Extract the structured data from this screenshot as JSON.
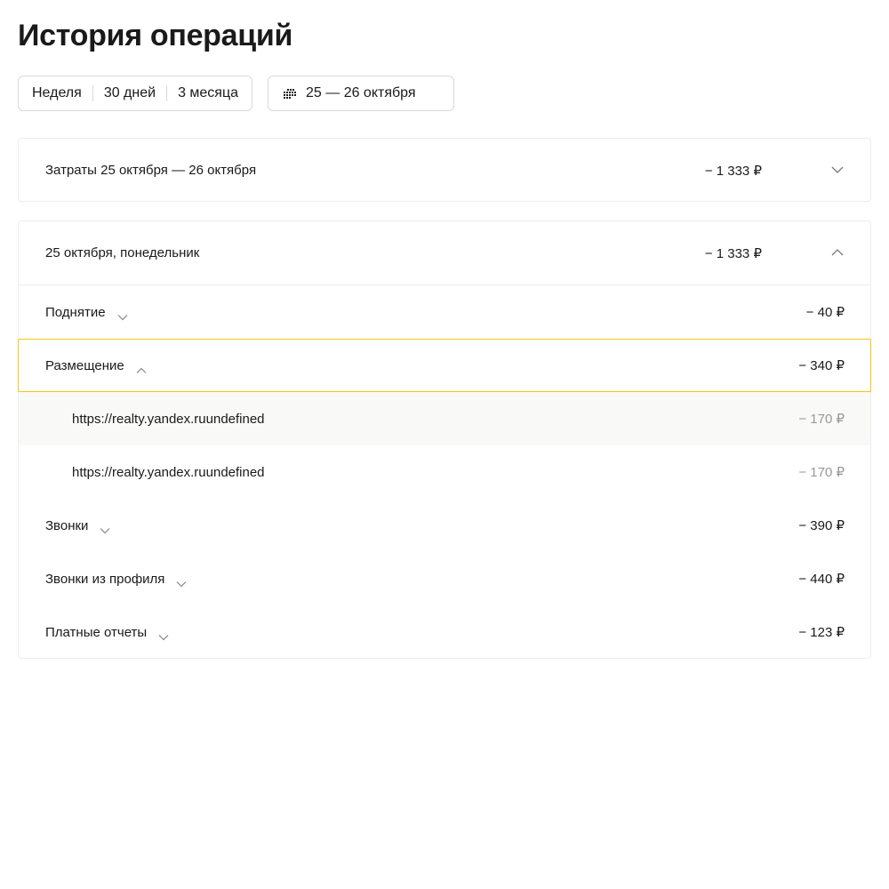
{
  "header": {
    "title": "История операций"
  },
  "period_switch": {
    "options": [
      "Неделя",
      "30 дней",
      "3 месяца"
    ]
  },
  "date_range": {
    "value": "25 — 26 октября",
    "icon": "calendar-icon"
  },
  "summary": {
    "label": "Затраты 25 октября — 26 октября",
    "amount": "− 1 333 ₽",
    "expanded": false
  },
  "day": {
    "label": "25 октября, понедельник",
    "amount": "− 1 333 ₽",
    "expanded": true,
    "items": [
      {
        "label": "Поднятие",
        "amount": "− 40 ₽",
        "expanded": false
      },
      {
        "label": "Размещение",
        "amount": "− 340 ₽",
        "expanded": true,
        "children": [
          {
            "label": "https://realty.yandex.ruundefined",
            "amount": "− 170 ₽"
          },
          {
            "label": "https://realty.yandex.ruundefined",
            "amount": "− 170 ₽"
          }
        ]
      },
      {
        "label": "Звонки",
        "amount": "− 390 ₽",
        "expanded": false
      },
      {
        "label": "Звонки из профиля",
        "amount": "− 440 ₽",
        "expanded": false
      },
      {
        "label": "Платные отчеты",
        "amount": "− 123 ₽",
        "expanded": false
      }
    ]
  },
  "colors": {
    "accent_border": "#f5c518",
    "muted_text": "#999999",
    "border": "#ececec"
  }
}
